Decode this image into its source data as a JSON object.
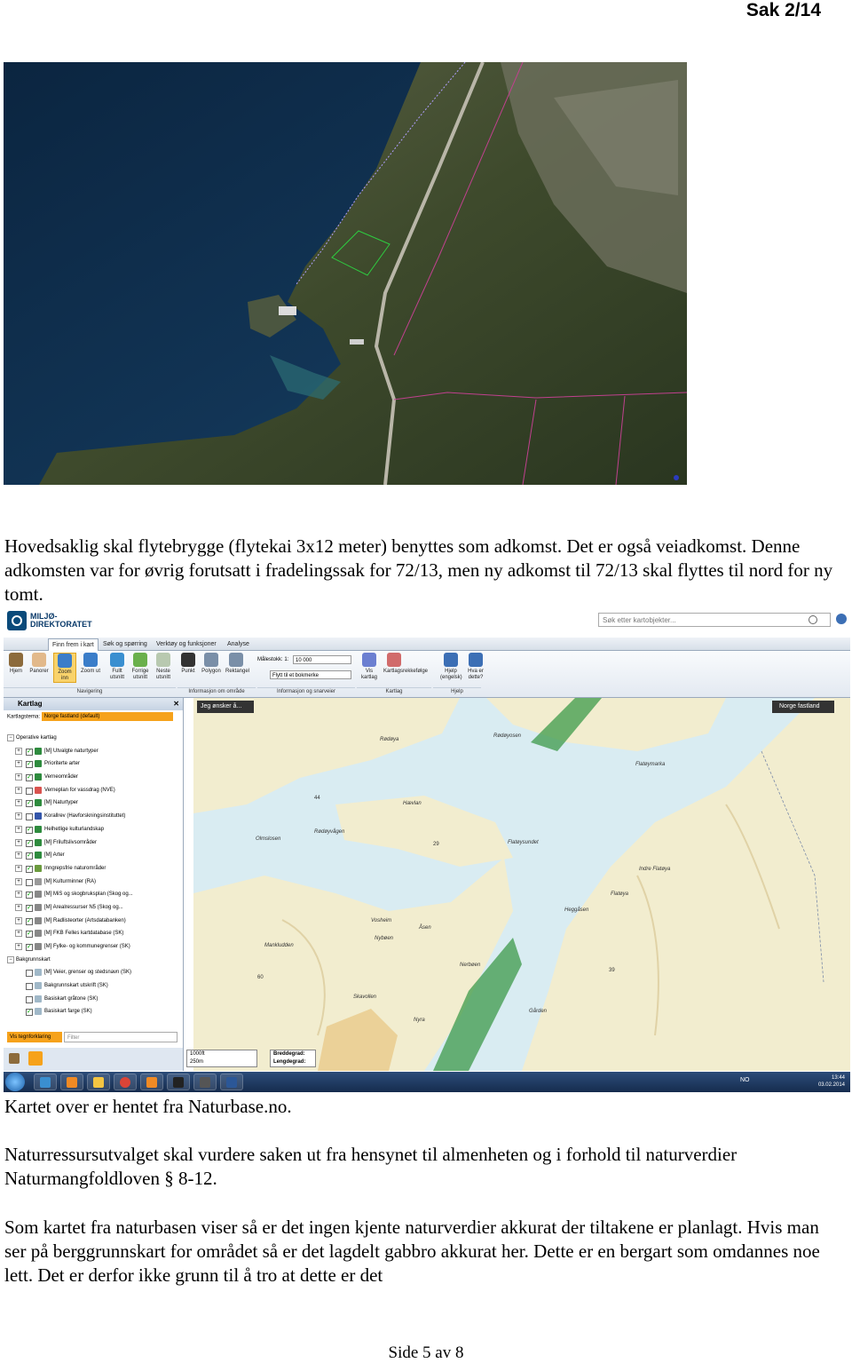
{
  "header": {
    "case_number": "Sak 2/14"
  },
  "paragraphs": {
    "p1": "Hovedsaklig skal flytebrygge (flytekai 3x12 meter) benyttes som adkomst. Det er også veiadkomst. Denne adkomsten var for øvrig forutsatt i fradelingssak for 72/13, men ny adkomst til 72/13 skal flyttes til nord for ny tomt.",
    "p2": "Kartet over er hentet fra Naturbase.no.",
    "p3": "Naturressursutvalget skal vurdere saken ut fra hensynet til almenheten og i forhold til naturverdier Naturmangfoldloven  § 8-12.",
    "p4": "Som kartet fra naturbasen viser så er det ingen kjente naturverdier akkurat der tiltakene er planlagt. Hvis man ser på berggrunnskart for området så er det lagdelt gabbro akkurat her. Dette er en bergart som omdannes noe lett. Det er derfor ikke grunn til å tro at dette er det"
  },
  "footer": {
    "page": "Side 5 av 8"
  },
  "screenshot": {
    "logo_text": "MILJØ- DIREKTORATET",
    "search_placeholder": "Søk etter kartobjekter...",
    "tabs": [
      "Finn frem i kart",
      "Søk og spørring",
      "Verktøy og funksjoner",
      "Analyse"
    ],
    "buttons": [
      {
        "label": "Hjem",
        "icon": "home-icon",
        "color": "#8c6b3c"
      },
      {
        "label": "Panorer",
        "icon": "hand-icon",
        "color": "#e2b98b"
      },
      {
        "label": "Zoom inn",
        "icon": "zoom-in-icon",
        "color": "#3a7dc9"
      },
      {
        "label": "Zoom ut",
        "icon": "zoom-out-icon",
        "color": "#3a7dc9"
      },
      {
        "label": "Fullt utsnitt",
        "icon": "globe-icon",
        "color": "#3a8fd0"
      },
      {
        "label": "Forrige utsnitt",
        "icon": "arrow-left-icon",
        "color": "#6ab04c"
      },
      {
        "label": "Neste utsnitt",
        "icon": "arrow-right-icon",
        "color": "#b8c9b0"
      },
      {
        "label": "Punkt",
        "icon": "info-icon",
        "color": "#333333"
      },
      {
        "label": "Polygon",
        "icon": "polygon-icon",
        "color": "#7a8fa8"
      },
      {
        "label": "Rektangel",
        "icon": "rectangle-icon",
        "color": "#7a8fa8"
      },
      {
        "label": "Vis kartlag",
        "icon": "layers-icon",
        "color": "#6b7fd1"
      },
      {
        "label": "Kartlagsrekkefølge",
        "icon": "layer-order-icon",
        "color": "#d16b6b"
      },
      {
        "label": "Hjelp (engelsk)",
        "icon": "help-icon",
        "color": "#3c6fb5"
      },
      {
        "label": "Hva er dette?",
        "icon": "what-icon",
        "color": "#3c6fb5"
      }
    ],
    "groups": [
      "Navigering",
      "Informasjon om område",
      "Informasjon og snarveier",
      "Kartlag",
      "Hjelp"
    ],
    "scale_label": "Målestokk: 1:",
    "scale_value": "10 000",
    "bookmark_label": "Flytt til et bokmerke",
    "panel_title": "Kartlag",
    "theme_label": "Kartlagstema:",
    "theme_value": "Norge fastland (default)",
    "group_operative": "Operative kartlag",
    "layers": [
      {
        "label": "[M] Utvalgte naturtyper",
        "checked": true,
        "color": "#2e8b3e"
      },
      {
        "label": "Prioriterte arter",
        "checked": true,
        "color": "#2e8b3e"
      },
      {
        "label": "Verneområder",
        "checked": true,
        "color": "#2e8b3e"
      },
      {
        "label": "Verneplan for vassdrag (NVE)",
        "checked": false,
        "color": "#d9534f"
      },
      {
        "label": "[M] Naturtyper",
        "checked": true,
        "color": "#2e8b3e"
      },
      {
        "label": "Korallrev (Havforskningsinstituttet)",
        "checked": false,
        "color": "#3355aa"
      },
      {
        "label": "Helhetlige kulturlandskap",
        "checked": true,
        "color": "#2e8b3e"
      },
      {
        "label": "[M] Friluftslivsområder",
        "checked": true,
        "color": "#2e8b3e"
      },
      {
        "label": "[M] Arter",
        "checked": true,
        "color": "#2e8b3e"
      },
      {
        "label": "Inngrepsfrie naturområder",
        "checked": true,
        "color": "#6b9b3e"
      },
      {
        "label": "[M] Kulturminner (RA)",
        "checked": false,
        "color": "#999999"
      },
      {
        "label": "[M] MiS og skogbruksplan (Skog og...",
        "checked": true,
        "color": "#888888"
      },
      {
        "label": "[M] Arealressurser N5 (Skog og...",
        "checked": true,
        "color": "#888888"
      },
      {
        "label": "[M] Radlisteorter (Artsdatabanken)",
        "checked": true,
        "color": "#888888"
      },
      {
        "label": "[M] FKB Felles kartdatabase (SK)",
        "checked": true,
        "color": "#888888"
      },
      {
        "label": "[M] Fylke- og kommunegrenser (SK)",
        "checked": true,
        "color": "#888888"
      }
    ],
    "group_background": "Bakgrunnskart",
    "background_layers": [
      {
        "label": "[M] Veier, grenser og stedsnavn (SK)",
        "checked": false
      },
      {
        "label": "Bakgrunnskart utskrift (SK)",
        "checked": false
      },
      {
        "label": "Basiskart gråtone (SK)",
        "checked": false
      },
      {
        "label": "Basiskart farge (SK)",
        "checked": true
      }
    ],
    "legend_button": "Vis tegnforklaring",
    "filter_placeholder": "Filter",
    "jeg_button": "Jeg ønsker å...",
    "background_select": "Norge fastland",
    "place_names": [
      "Rødøya",
      "Rødøyosen",
      "Flatøymarka",
      "Hævlan",
      "Rødøyvågen",
      "Flatøysundet",
      "Indre Flatøya",
      "Flatøya",
      "Heggåsen",
      "Vosheim",
      "Åsen",
      "Nybøen",
      "Mankludden",
      "Nerbøen",
      "Skavollen",
      "Nyra",
      "Gården",
      "Olmslosen"
    ],
    "elevations": [
      "44",
      "29",
      "60",
      "39"
    ],
    "scalebar": [
      "1000ft",
      "250m"
    ],
    "coords_lat": "Breddegrad:",
    "coords_lon": "Lengdegrad:",
    "tray_lang": "NO",
    "tray_time": "13:44",
    "tray_date": "03.02.2014"
  }
}
